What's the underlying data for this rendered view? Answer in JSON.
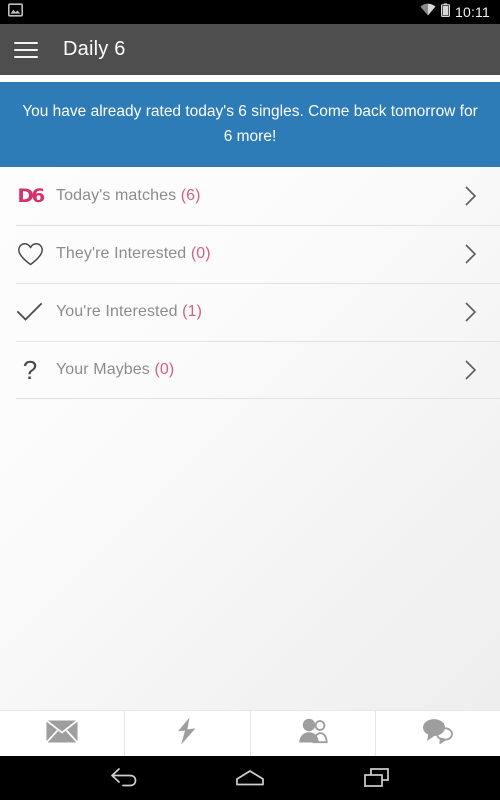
{
  "statusbar": {
    "time": "10:11",
    "left_icons": [
      {
        "name": "image-icon"
      }
    ],
    "right_icons": [
      {
        "name": "wifi-icon"
      },
      {
        "name": "battery-icon"
      }
    ]
  },
  "appbar": {
    "menu_icon": "hamburger-menu-icon",
    "title": "Daily 6",
    "background": "#4e4e4e"
  },
  "banner": {
    "message": "You have already rated today's 6 singles. Come back tomorrow for 6 more!",
    "background": "#2d7cb8",
    "text_color": "#ffffff"
  },
  "list": {
    "accent_color": "#d4607f",
    "rows": [
      {
        "icon": "d6-logo-icon",
        "icon_text": "D6",
        "label": "Today's matches",
        "count": "(6)",
        "chevron": "chevron-right-icon"
      },
      {
        "icon": "heart-outline-icon",
        "icon_text": "",
        "label": "They're Interested",
        "count": "(0)",
        "chevron": "chevron-right-icon"
      },
      {
        "icon": "check-icon",
        "icon_text": "",
        "label": "You're Interested",
        "count": "(1)",
        "chevron": "chevron-right-icon"
      },
      {
        "icon": "question-mark-icon",
        "icon_text": "?",
        "label": "Your Maybes",
        "count": "(0)",
        "chevron": "chevron-right-icon"
      }
    ]
  },
  "tabbar": {
    "tabs": [
      {
        "icon": "mail-envelope-icon"
      },
      {
        "icon": "lightning-bolt-icon"
      },
      {
        "icon": "people-group-icon"
      },
      {
        "icon": "chat-bubbles-icon"
      }
    ]
  },
  "navbar": {
    "buttons": [
      {
        "icon": "back-icon"
      },
      {
        "icon": "home-icon"
      },
      {
        "icon": "recents-icon"
      }
    ]
  }
}
